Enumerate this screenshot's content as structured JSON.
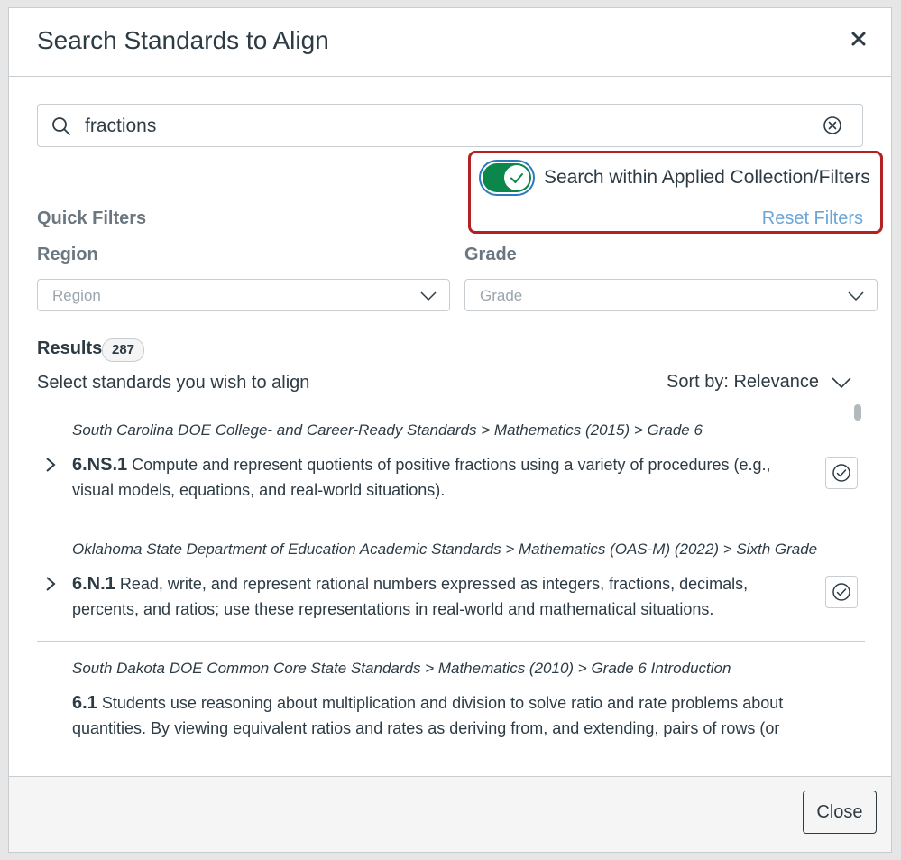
{
  "modal": {
    "title": "Search Standards to Align",
    "close_icon": "close-x-icon"
  },
  "search": {
    "value": "fractions",
    "placeholder": "",
    "icon": "search-icon",
    "clear_icon": "clear-circle-x-icon"
  },
  "toggle": {
    "label": "Search within Applied Collection/Filters",
    "on": true,
    "color": "#0b874b"
  },
  "reset_filters": "Reset Filters",
  "quick_filters": {
    "heading": "Quick Filters",
    "region": {
      "label": "Region",
      "placeholder": "Region"
    },
    "grade": {
      "label": "Grade",
      "placeholder": "Grade"
    }
  },
  "results": {
    "title": "Results",
    "count": "287",
    "hint": "Select standards you wish to align",
    "sort_label": "Sort by: Relevance",
    "items": [
      {
        "path": "South Carolina DOE College- and Career-Ready Standards > Mathematics (2015) > Grade 6",
        "code": "6.NS.1",
        "text": " Compute and represent quotients of positive fractions using a variety of procedures (e.g., visual models, equations, and real-world situations)."
      },
      {
        "path": "Oklahoma State Department of Education Academic Standards > Mathematics (OAS-M) (2022) > Sixth Grade",
        "code": "6.N.1",
        "text": " Read, write, and represent rational numbers expressed as integers, fractions, decimals, percents, and ratios; use these representations in real-world and mathematical situations."
      },
      {
        "path": "South Dakota DOE Common Core State Standards > Mathematics (2010) > Grade 6 Introduction",
        "code": "6.1",
        "text": " Students use reasoning about multiplication and division to solve ratio and rate problems about quantities. By viewing equivalent ratios and rates as deriving from, and extending, pairs of rows (or"
      }
    ]
  },
  "footer": {
    "close_label": "Close"
  },
  "colors": {
    "highlight": "#b22222",
    "link": "#6aa6d8",
    "text": "#2d3b45",
    "toggle_on": "#0b874b"
  }
}
